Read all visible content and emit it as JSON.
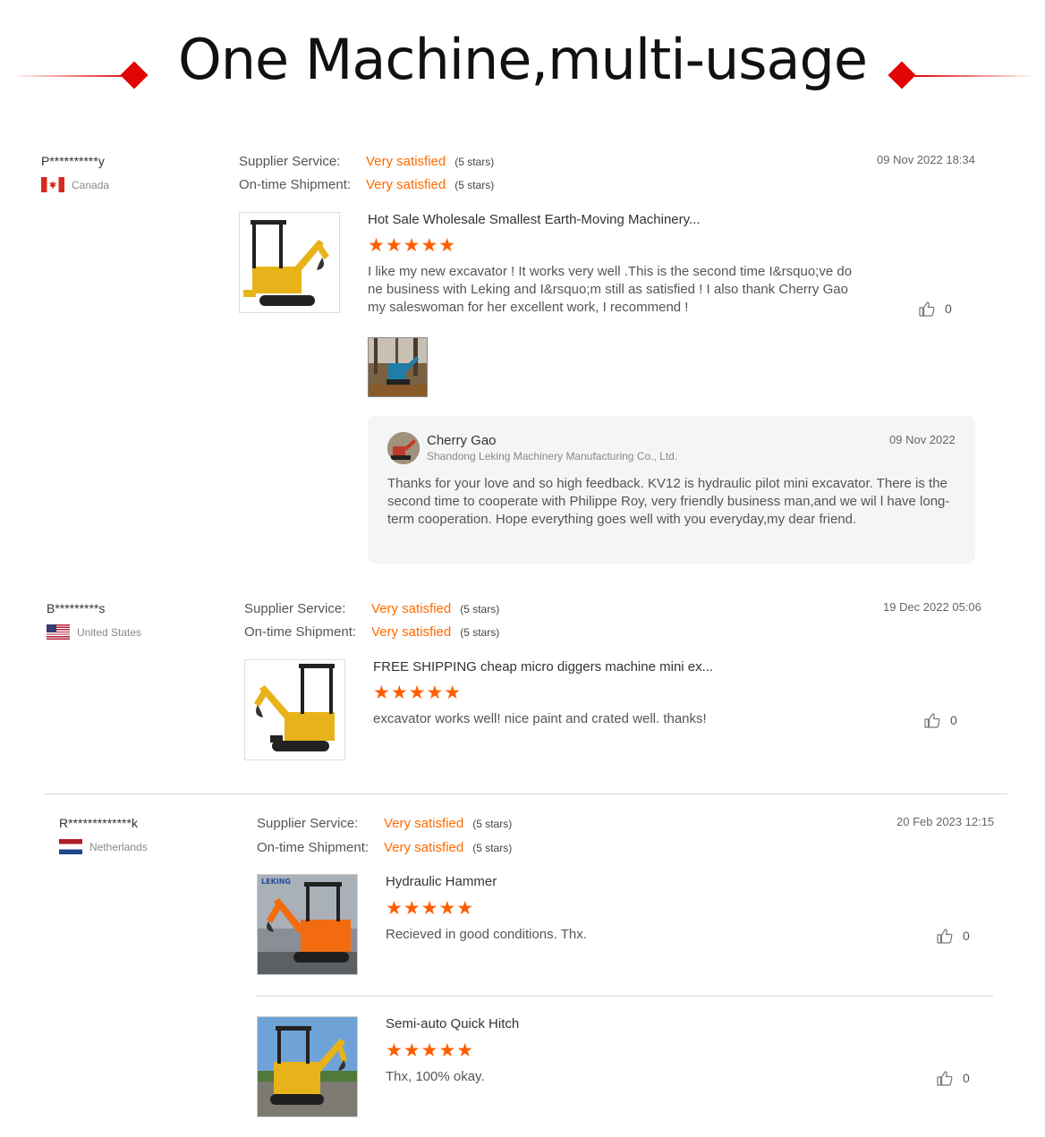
{
  "header": {
    "title": "One Machine,multi-usage"
  },
  "colors": {
    "accent": "#e20505",
    "orange": "#ff6a00",
    "star": "#ff5e00"
  },
  "reviews": [
    {
      "buyer": "P**********y",
      "country": "Canada",
      "flag_icon": "canada-flag-icon",
      "supplier_service_label": "Supplier Service:",
      "supplier_service_value": "Very satisfied",
      "supplier_service_stars": "(5 stars)",
      "shipment_label": "On-time Shipment:",
      "shipment_value": "Very satisfied",
      "shipment_stars": "(5 stars)",
      "timestamp": "09 Nov 2022 18:34",
      "items": [
        {
          "title": "Hot Sale Wholesale Smallest Earth-Moving Machinery...",
          "stars": "★★★★★",
          "rating": 5,
          "text": "I like my new excavator ! It works very well .This is the second time I&rsquo;ve do ne business with Leking and I&rsquo;m still as satisfied ! I also thank Cherry Gao my saleswoman for her excellent work, I recommend !",
          "likes": "0"
        }
      ],
      "reply": {
        "name": "Cherry Gao",
        "company": "Shandong Leking Machinery Manufacturing Co., Ltd.",
        "date": "09 Nov 2022",
        "text": "Thanks for your love and so high feedback. KV12 is hydraulic pilot mini excavator. There is the second time to cooperate with Philippe Roy, very friendly business man,and we wil l have long-term cooperation. Hope everything goes well with you everyday,my dear friend."
      }
    },
    {
      "buyer": "B*********s",
      "country": "United States",
      "flag_icon": "us-flag-icon",
      "supplier_service_label": "Supplier Service:",
      "supplier_service_value": "Very satisfied",
      "supplier_service_stars": "(5 stars)",
      "shipment_label": "On-time Shipment:",
      "shipment_value": "Very satisfied",
      "shipment_stars": "(5 stars)",
      "timestamp": "19 Dec 2022 05:06",
      "items": [
        {
          "title": "FREE SHIPPING cheap micro diggers machine mini ex...",
          "stars": "★★★★★",
          "rating": 5,
          "text": "excavator works well! nice paint and crated well. thanks!",
          "likes": "0"
        }
      ]
    },
    {
      "buyer": "R*************k",
      "country": "Netherlands",
      "flag_icon": "netherlands-flag-icon",
      "supplier_service_label": "Supplier Service:",
      "supplier_service_value": "Very satisfied",
      "supplier_service_stars": "(5 stars)",
      "shipment_label": "On-time Shipment:",
      "shipment_value": "Very satisfied",
      "shipment_stars": "(5 stars)",
      "timestamp": "20 Feb 2023 12:15",
      "items": [
        {
          "title": "Hydraulic Hammer",
          "stars": "★★★★★",
          "rating": 5,
          "text": "Recieved in good conditions. Thx.",
          "likes": "0",
          "brand_text": "LEKING"
        },
        {
          "title": "Semi-auto Quick Hitch",
          "stars": "★★★★★",
          "rating": 5,
          "text": "Thx, 100% okay.",
          "likes": "0"
        }
      ]
    }
  ]
}
